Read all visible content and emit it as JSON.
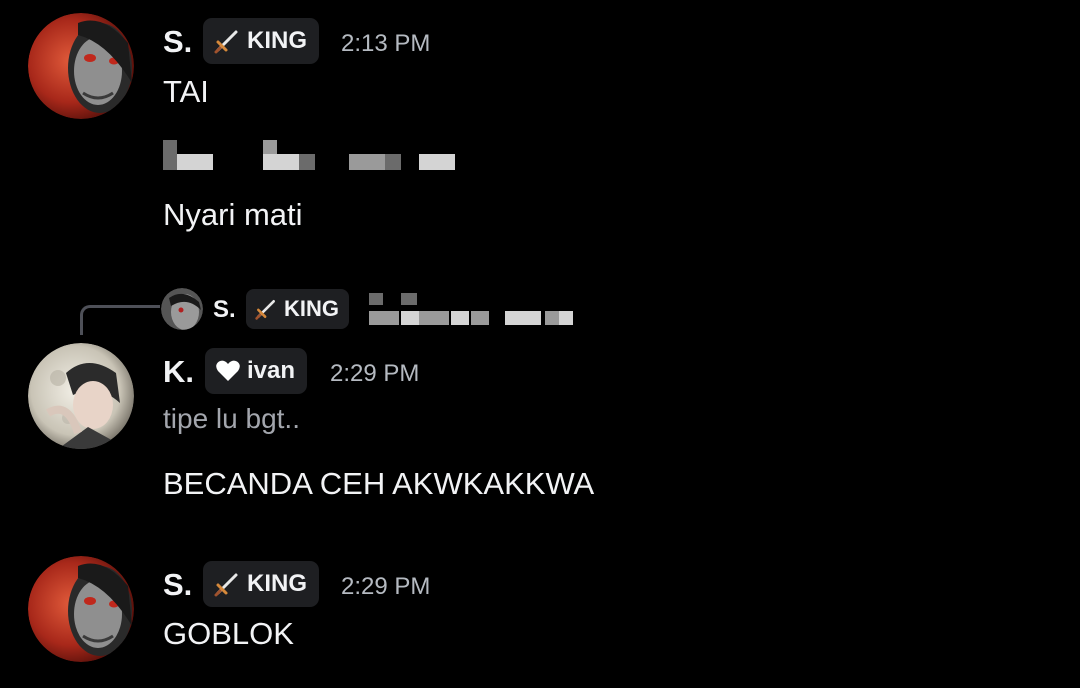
{
  "messages": [
    {
      "username": "S.",
      "tag": {
        "label": "KING",
        "icon": "sword-icon"
      },
      "timestamp": "2:13 PM",
      "lines": [
        "TAI",
        "Nyari mati"
      ]
    },
    {
      "reply_to": {
        "username": "S.",
        "tag": {
          "label": "KING",
          "icon": "sword-icon"
        }
      },
      "username": "K.",
      "tag": {
        "label": "ivan",
        "icon": "heart-icon"
      },
      "timestamp": "2:29 PM",
      "lines": [
        "tipe lu bgt..",
        "BECANDA CEH AKWKAKKWA"
      ]
    },
    {
      "username": "S.",
      "tag": {
        "label": "KING",
        "icon": "sword-icon"
      },
      "timestamp": "2:29 PM",
      "lines": [
        "GOBLOK"
      ]
    }
  ],
  "colors": {
    "background": "#000000",
    "tag_background": "#1e1f22",
    "text": "#f2f3f5",
    "timestamp": "#b5bac1",
    "muted_text": "#a3a6ad",
    "reply_line": "#4e5058"
  }
}
